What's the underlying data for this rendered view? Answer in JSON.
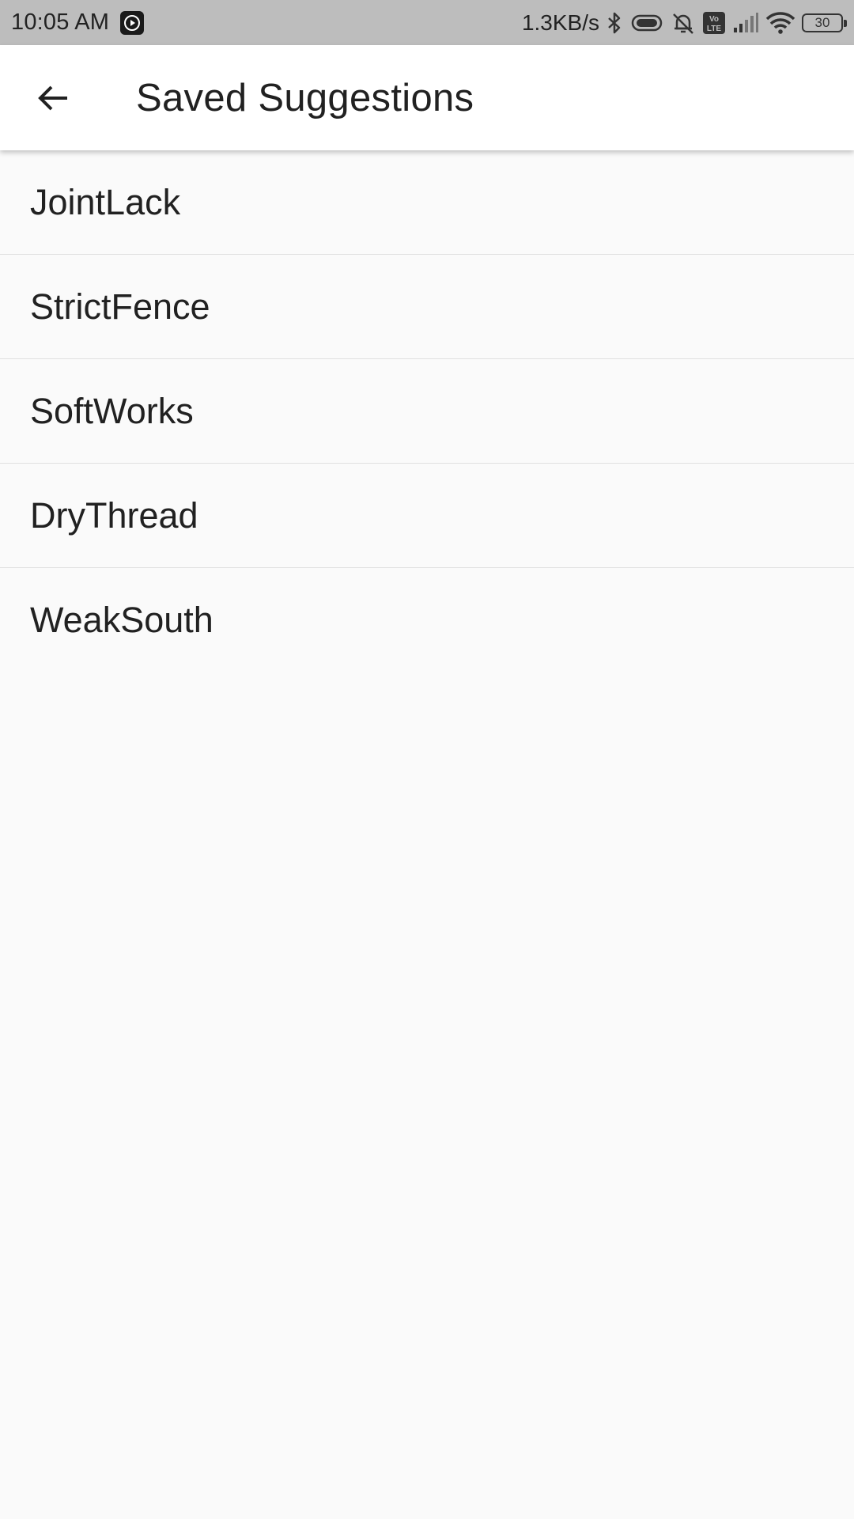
{
  "status_bar": {
    "time": "10:05 AM",
    "net_speed": "1.3KB/s",
    "battery_level": "30",
    "icons": [
      "app-notification-icon",
      "bluetooth-icon",
      "vibrate-icon",
      "alarm-off-icon",
      "volte-icon",
      "cellular-signal-icon",
      "wifi-icon",
      "battery-icon"
    ],
    "volte_label": "Vo LTE"
  },
  "app_bar": {
    "title": "Saved Suggestions",
    "back_icon": "arrow-back-icon"
  },
  "saved_list": {
    "items": [
      {
        "label": "JointLack"
      },
      {
        "label": "StrictFence"
      },
      {
        "label": "SoftWorks"
      },
      {
        "label": "DryThread"
      },
      {
        "label": "WeakSouth"
      }
    ]
  },
  "colors": {
    "status_bar_bg": "#bdbdbd",
    "app_bar_bg": "#ffffff",
    "page_bg": "#fafafa",
    "divider": "#e0e0e0",
    "text": "#212121"
  }
}
